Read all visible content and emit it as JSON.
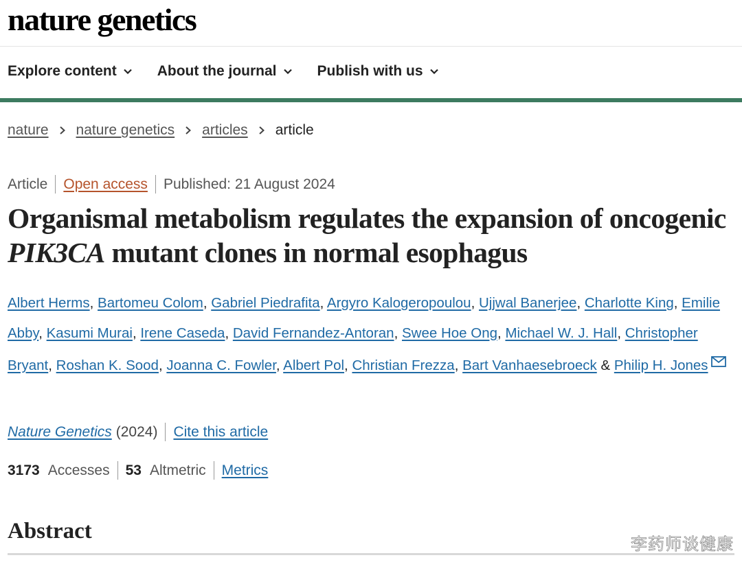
{
  "site": {
    "logo": "nature genetics"
  },
  "nav": {
    "items": [
      {
        "label": "Explore content",
        "icon": "chevron-down-icon"
      },
      {
        "label": "About the journal",
        "icon": "chevron-down-icon"
      },
      {
        "label": "Publish with us",
        "icon": "chevron-down-icon"
      }
    ]
  },
  "breadcrumb": {
    "items": [
      "nature",
      "nature genetics",
      "articles"
    ],
    "current": "article"
  },
  "article_meta": {
    "type": "Article",
    "access": "Open access",
    "published": "Published: 21 August 2024"
  },
  "title": {
    "part1": "Organismal metabolism regulates the expansion of oncogenic ",
    "gene": "PIK3CA",
    "part2": " mutant clones in normal esophagus"
  },
  "authors": [
    "Albert Herms",
    "Bartomeu Colom",
    "Gabriel Piedrafita",
    "Argyro Kalogeropoulou",
    "Ujjwal Banerjee",
    "Charlotte King",
    "Emilie Abby",
    "Kasumi Murai",
    "Irene Caseda",
    "David Fernandez-Antoran",
    "Swee Hoe Ong",
    "Michael W. J. Hall",
    "Christopher Bryant",
    "Roshan K. Sood",
    "Joanna C. Fowler",
    "Albert Pol",
    "Christian Frezza",
    "Bart Vanhaesebroeck",
    "Philip H. Jones"
  ],
  "author_separators": {
    "comma": ", ",
    "and": " & "
  },
  "corresponding_icon": "envelope-icon",
  "citation": {
    "journal": "Nature Genetics",
    "year": "(2024)",
    "cite_label": "Cite this article"
  },
  "metrics": {
    "accesses_count": "3173",
    "accesses_label": "Accesses",
    "altmetric_count": "53",
    "altmetric_label": "Altmetric",
    "metrics_link": "Metrics"
  },
  "section": {
    "abstract_heading": "Abstract"
  },
  "watermark": "李药师谈健康",
  "colors": {
    "accent_green": "#3d7b60",
    "link_blue": "#1f6aa5",
    "open_access": "#b5542c",
    "text": "#222222"
  }
}
